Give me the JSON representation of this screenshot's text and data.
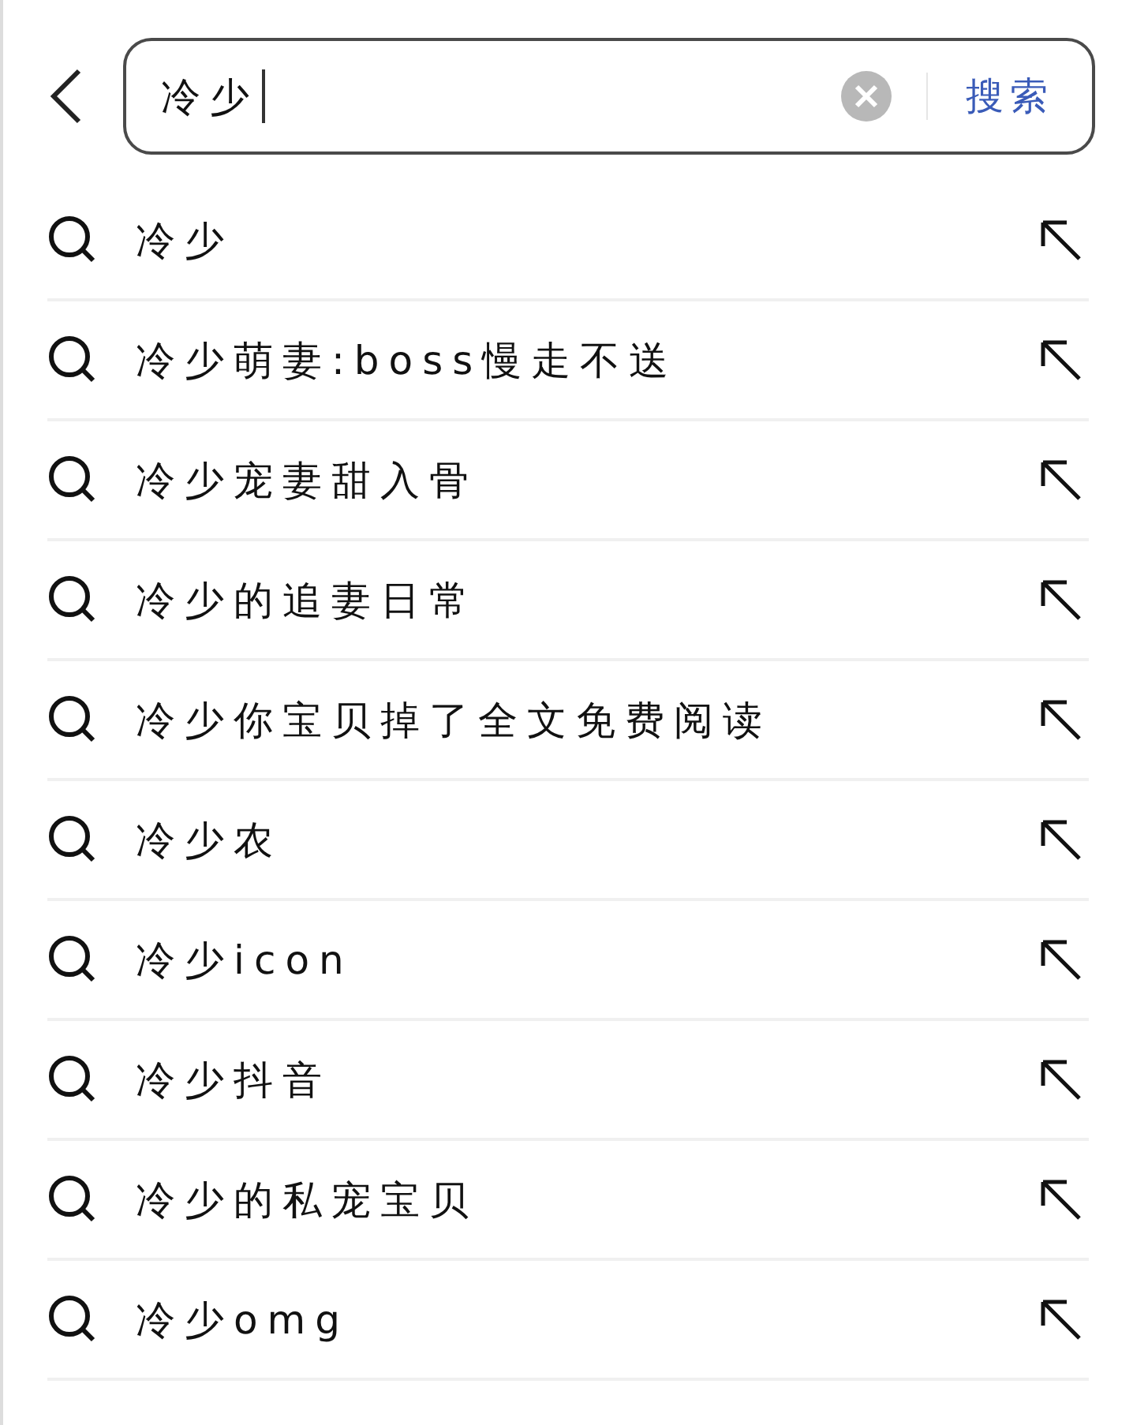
{
  "search_bar": {
    "value": "冷少",
    "search_button": "搜索"
  },
  "suggestions": [
    {
      "text": "冷少"
    },
    {
      "text": "冷少萌妻:boss慢走不送"
    },
    {
      "text": "冷少宠妻甜入骨"
    },
    {
      "text": "冷少的追妻日常"
    },
    {
      "text": "冷少你宝贝掉了全文免费阅读"
    },
    {
      "text": "冷少农"
    },
    {
      "text": "冷少icon"
    },
    {
      "text": "冷少抖音"
    },
    {
      "text": "冷少的私宠宝贝"
    },
    {
      "text": "冷少omg"
    }
  ]
}
